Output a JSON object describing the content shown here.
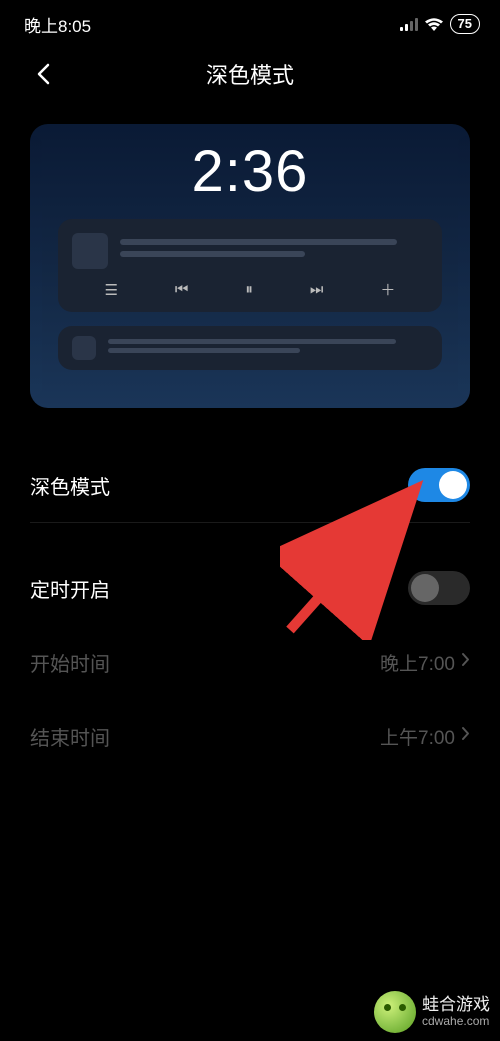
{
  "status": {
    "time": "晚上8:05",
    "battery": "75"
  },
  "header": {
    "title": "深色模式"
  },
  "preview": {
    "time": "2:36"
  },
  "settings": {
    "dark_mode": {
      "label": "深色模式"
    },
    "scheduled": {
      "label": "定时开启"
    },
    "start_time": {
      "label": "开始时间",
      "value": "晚上7:00"
    },
    "end_time": {
      "label": "结束时间",
      "value": "上午7:00"
    }
  },
  "watermark": {
    "name": "蛙合游戏",
    "url": "cdwahe.com"
  }
}
